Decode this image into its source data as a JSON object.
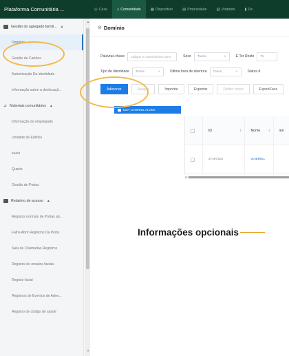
{
  "app": {
    "title": "Plataforma Comunitária ..."
  },
  "nav": [
    {
      "label": "Casa",
      "icon": "home-icon",
      "glyph": "◎"
    },
    {
      "label": "Comunidade",
      "icon": "community-icon",
      "glyph": "⌂",
      "active": true
    },
    {
      "label": "Dispositivo",
      "icon": "device-icon",
      "glyph": "▦"
    },
    {
      "label": "Propriedade",
      "icon": "property-icon",
      "glyph": "▤"
    },
    {
      "label": "Visitante",
      "icon": "visitor-icon",
      "glyph": "▥"
    },
    {
      "label": "De",
      "icon": "data-icon",
      "glyph": "▮"
    }
  ],
  "sidebar": {
    "groups": [
      {
        "label": "Gestão do agregado famili...",
        "icon": "household-icon",
        "items": [
          {
            "label": "Domínio",
            "active": true
          },
          {
            "label": "Gestão de Cartões"
          },
          {
            "label": "Autenticação Da identidade"
          },
          {
            "label": "Informação sobre a deslocaçã..."
          }
        ]
      },
      {
        "label": "Materiais comunitários",
        "icon": "materials-icon",
        "items": [
          {
            "label": "Informação do empregado"
          },
          {
            "label": "Unidade de Edifício"
          },
          {
            "label": "suelo"
          },
          {
            "label": "Quarto"
          },
          {
            "label": "Gestão de Portas"
          }
        ]
      },
      {
        "label": "Relatório de acesso",
        "icon": "report-icon",
        "items": [
          {
            "label": "Registos normais de Portas ab..."
          },
          {
            "label": "Falha Abrir Registros Da Porta"
          },
          {
            "label": "Sala de Chamadas Registros"
          },
          {
            "label": "Registos de ensaios faciais"
          },
          {
            "label": "Registo facial"
          },
          {
            "label": "Registros de Eventos de Adve..."
          },
          {
            "label": "Registro de código de saúde"
          }
        ]
      }
    ]
  },
  "page": {
    "title": "Domínio"
  },
  "filters": {
    "row1": {
      "keyword_label": "Palavras-chave",
      "keyword_placeholder": "Indique o nome/número de tr",
      "sex_label": "Sexo",
      "sex_value": "Todos.",
      "photo_label": "É Ter Rosto",
      "photo_value": "To"
    },
    "row2": {
      "idtype_label": "Tipo de Identidade",
      "idtype_value": "Todos.",
      "lastopen_label": "Última hora de abertura",
      "lastopen_value": "Todos.",
      "status_label": "Status d"
    }
  },
  "actions": {
    "add": "Adicionar",
    "delete": "Apagar",
    "import": "Importar",
    "export": "Exportar",
    "default_label": "Definir rótulo",
    "export_face": "ExportFace"
  },
  "tree": {
    "node": "IZZY GABRIEL ALVES"
  },
  "table": {
    "headers": {
      "id": "ID",
      "name": "Nome",
      "extra": "En"
    },
    "rows": [
      {
        "id": "37497202",
        "name": "GABRIEL",
        "extra": ""
      }
    ]
  },
  "annotation": {
    "text": "Informações opcionais"
  },
  "colors": {
    "topbar": "#0f3d2c",
    "primary": "#1d7de6",
    "highlight": "#f2b84b"
  }
}
